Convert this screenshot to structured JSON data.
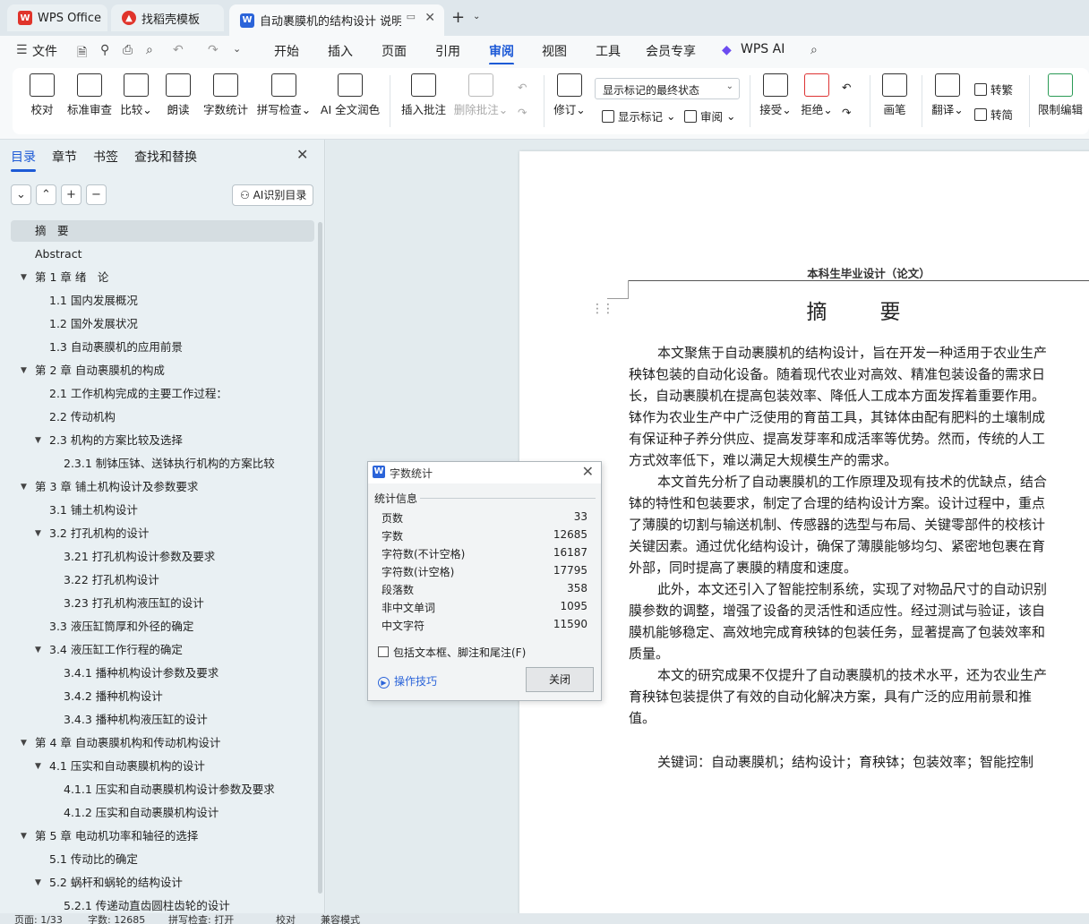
{
  "tabs": {
    "wps_office": "WPS Office",
    "template": "找稻壳模板",
    "document": "自动裹膜机的结构设计 说明书"
  },
  "menu": {
    "file": "文件",
    "items": [
      "开始",
      "插入",
      "页面",
      "引用",
      "审阅",
      "视图",
      "工具",
      "会员专享"
    ],
    "active": "审阅",
    "wps_ai": "WPS AI"
  },
  "ribbon": {
    "proofread": "校对",
    "std_review": "标准审查",
    "compare": "比较",
    "read_aloud": "朗读",
    "word_count": "字数统计",
    "spell_check": "拼写检查",
    "ai_polish": "AI 全文润色",
    "insert_comment": "插入批注",
    "delete_comment": "删除批注",
    "track_changes": "修订",
    "mode_select": "显示标记的最终状态",
    "show_markup": "显示标记",
    "review": "审阅",
    "accept": "接受",
    "reject": "拒绝",
    "pen": "画笔",
    "translate": "翻译",
    "to_traditional": "转繁",
    "to_simplified": "转简",
    "restrict_edit": "限制编辑"
  },
  "nav": {
    "tabs": [
      "目录",
      "章节",
      "书签",
      "查找和替换"
    ],
    "active_tab": "目录",
    "ai_toc": "AI识别目录",
    "toc": [
      {
        "text": "摘　要",
        "level": 1,
        "arrow": false,
        "selected": true
      },
      {
        "text": "Abstract",
        "level": 1,
        "arrow": false
      },
      {
        "text": "第 1 章  绪　论",
        "level": 1,
        "arrow": true
      },
      {
        "text": "1.1  国内发展概况",
        "level": 2,
        "arrow": false
      },
      {
        "text": "1.2  国外发展状况",
        "level": 2,
        "arrow": false
      },
      {
        "text": "1.3  自动裹膜机的应用前景",
        "level": 2,
        "arrow": false
      },
      {
        "text": "第 2 章  自动裹膜机的构成",
        "level": 1,
        "arrow": true
      },
      {
        "text": "2.1  工作机构完成的主要工作过程：",
        "level": 2,
        "arrow": false
      },
      {
        "text": "2.2  传动机构",
        "level": 2,
        "arrow": false
      },
      {
        "text": "2.3  机构的方案比较及选择",
        "level": 2,
        "arrow": true
      },
      {
        "text": "2.3.1  制钵压钵、送钵执行机构的方案比较",
        "level": 3,
        "arrow": false
      },
      {
        "text": "第 3 章  铺土机构设计及参数要求",
        "level": 1,
        "arrow": true
      },
      {
        "text": "3.1  铺土机构设计",
        "level": 2,
        "arrow": false
      },
      {
        "text": "3.2  打孔机构的设计",
        "level": 2,
        "arrow": true
      },
      {
        "text": "3.21  打孔机构设计参数及要求",
        "level": 3,
        "arrow": false
      },
      {
        "text": "3.22  打孔机构设计",
        "level": 3,
        "arrow": false
      },
      {
        "text": "3.23  打孔机构液压缸的设计",
        "level": 3,
        "arrow": false
      },
      {
        "text": "3.3  液压缸筒厚和外径的确定",
        "level": 2,
        "arrow": false
      },
      {
        "text": "3.4  液压缸工作行程的确定",
        "level": 2,
        "arrow": true
      },
      {
        "text": "3.4.1  播种机构设计参数及要求",
        "level": 3,
        "arrow": false
      },
      {
        "text": "3.4.2  播种机构设计",
        "level": 3,
        "arrow": false
      },
      {
        "text": "3.4.3  播种机构液压缸的设计",
        "level": 3,
        "arrow": false
      },
      {
        "text": "第 4 章  自动裹膜机构和传动机构设计",
        "level": 1,
        "arrow": true
      },
      {
        "text": "4.1  压实和自动裹膜机构的设计",
        "level": 2,
        "arrow": true
      },
      {
        "text": "4.1.1  压实和自动裹膜机构设计参数及要求",
        "level": 3,
        "arrow": false
      },
      {
        "text": "4.1.2  压实和自动裹膜机构设计",
        "level": 3,
        "arrow": false
      },
      {
        "text": "第 5 章  电动机功率和轴径的选择",
        "level": 1,
        "arrow": true
      },
      {
        "text": "5.1  传动比的确定",
        "level": 2,
        "arrow": false
      },
      {
        "text": "5.2  蜗杆和蜗轮的结构设计",
        "level": 2,
        "arrow": true
      },
      {
        "text": "5.2.1  传递动直齿圆柱齿轮的设计",
        "level": 3,
        "arrow": false
      }
    ]
  },
  "document": {
    "header": "本科生毕业设计（论文）",
    "title": "摘　要",
    "lines": [
      {
        "t": "本文聚焦于自动裹膜机的结构设计，旨在开发一种适用于农业生产",
        "ind": true
      },
      {
        "t": "秧钵包装的自动化设备。随着现代农业对高效、精准包装设备的需求日",
        "ind": false
      },
      {
        "t": "长，自动裹膜机在提高包装效率、降低人工成本方面发挥着重要作用。",
        "ind": false
      },
      {
        "t": "钵作为农业生产中广泛使用的育苗工具，其钵体由配有肥料的土壤制成",
        "ind": false
      },
      {
        "t": "有保证种子养分供应、提高发芽率和成活率等优势。然而，传统的人工",
        "ind": false
      },
      {
        "t": "方式效率低下，难以满足大规模生产的需求。",
        "ind": false
      },
      {
        "t": "本文首先分析了自动裹膜机的工作原理及现有技术的优缺点，结合",
        "ind": true
      },
      {
        "t": "钵的特性和包装要求，制定了合理的结构设计方案。设计过程中，重点",
        "ind": false
      },
      {
        "t": "了薄膜的切割与输送机制、传感器的选型与布局、关键零部件的校核计",
        "ind": false
      },
      {
        "t": "关键因素。通过优化结构设计，确保了薄膜能够均匀、紧密地包裹在育",
        "ind": false
      },
      {
        "t": "外部，同时提高了裹膜的精度和速度。",
        "ind": false
      },
      {
        "t": "此外，本文还引入了智能控制系统，实现了对物品尺寸的自动识别",
        "ind": true
      },
      {
        "t": "膜参数的调整，增强了设备的灵活性和适应性。经过测试与验证，该自",
        "ind": false
      },
      {
        "t": "膜机能够稳定、高效地完成育秧钵的包装任务，显著提高了包装效率和",
        "ind": false
      },
      {
        "t": "质量。",
        "ind": false
      },
      {
        "t": "本文的研究成果不仅提升了自动裹膜机的技术水平，还为农业生产",
        "ind": true
      },
      {
        "t": "育秧钵包装提供了有效的自动化解决方案，具有广泛的应用前景和推",
        "ind": false
      },
      {
        "t": "值。",
        "ind": false
      }
    ],
    "keywords": "关键词：自动裹膜机；结构设计；育秧钵；包装效率；智能控制"
  },
  "dialog": {
    "title": "字数统计",
    "group": "统计信息",
    "stats": [
      {
        "k": "页数",
        "v": "33"
      },
      {
        "k": "字数",
        "v": "12685"
      },
      {
        "k": "字符数(不计空格)",
        "v": "16187"
      },
      {
        "k": "字符数(计空格)",
        "v": "17795"
      },
      {
        "k": "段落数",
        "v": "358"
      },
      {
        "k": "非中文单词",
        "v": "1095"
      },
      {
        "k": "中文字符",
        "v": "11590"
      }
    ],
    "include_label": "包括文本框、脚注和尾注(F)",
    "tips": "操作技巧",
    "close": "关闭"
  },
  "status": {
    "page": "页面: 1/33",
    "words": "字数: 12685",
    "spell": "拼写检查: 打开",
    "proof": "校对",
    "compat": "兼容模式"
  },
  "colors": {
    "accent": "#1d5ad6",
    "wps_red": "#e0342b"
  }
}
